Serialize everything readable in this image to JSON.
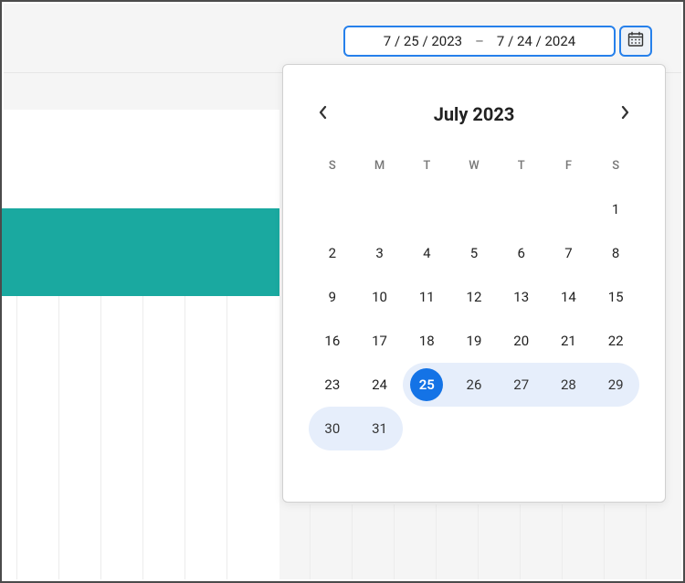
{
  "dateRange": {
    "start": "7 / 25 / 2023",
    "dash": "–",
    "end": "7 / 24 / 2024"
  },
  "calendar": {
    "title": "July 2023",
    "dow": [
      "S",
      "M",
      "T",
      "W",
      "T",
      "F",
      "S"
    ],
    "blanks": 6,
    "selectedStart": 25,
    "rangeDays": [
      25,
      26,
      27,
      28,
      29,
      30,
      31
    ],
    "days": [
      "1",
      "2",
      "3",
      "4",
      "5",
      "6",
      "7",
      "8",
      "9",
      "10",
      "11",
      "12",
      "13",
      "14",
      "15",
      "16",
      "17",
      "18",
      "19",
      "20",
      "21",
      "22",
      "23",
      "24",
      "25",
      "26",
      "27",
      "28",
      "29",
      "30",
      "31"
    ]
  }
}
